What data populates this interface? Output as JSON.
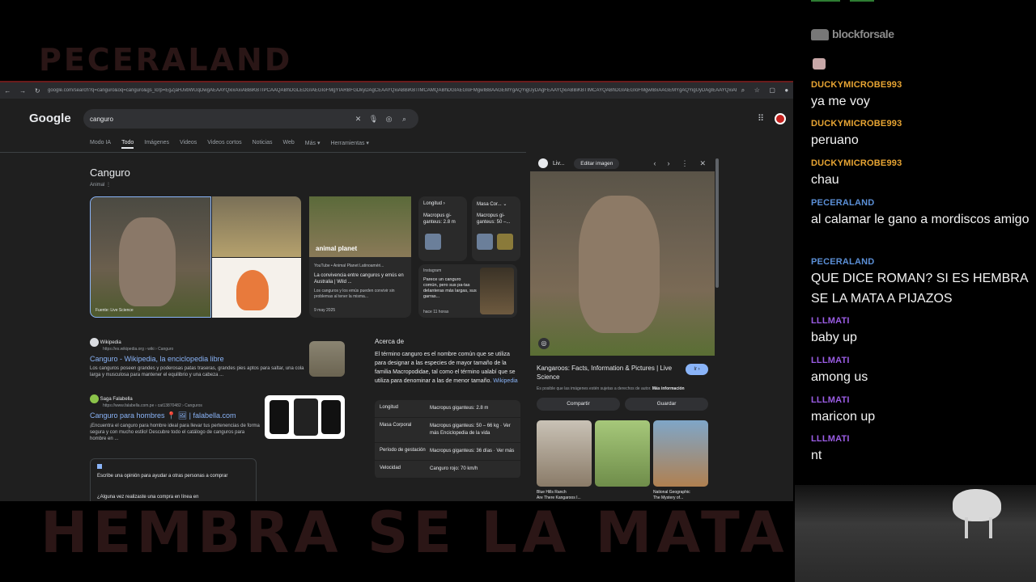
{
  "overlay": {
    "ghost_top": "PECERALAND",
    "ghost_bottom": "HEMBRA SE LA MATA A F"
  },
  "browser": {
    "url": "google.com/search?q=canguro&oq=canguro&gs_lcrp=EgZjaHJvbWUqDwgAEAAYQxixAxiABBiKBTIPCAAQABhDGLEDGIAEGIoFMgYIARBFGDkyDAgCEAAYQxiABBiKBTIMCAMQABhDGIAEGIoFMgwIBBAAGEMYgAQYigUyDAgFEAAYQxiABBiKBTIMCAYQABhDGIAEGIoFMgwIBxAAGEMYgAQYigUyDAgIEAAYQxiABBiKBTIMCAkQABhDGIAEGIoF0gEIMTYyNGowajeoAgCwAgA&sourceid=chrome&ie=UTF-8"
  },
  "google": {
    "logo": "Google",
    "query": "canguro",
    "tabs": [
      "Modo IA",
      "Todo",
      "Imágenes",
      "Videos",
      "Videos cortos",
      "Noticias",
      "Web",
      "Más ▾",
      "Herramientas ▾"
    ],
    "kp_title": "Canguro",
    "kp_sub": "Animal ⋮",
    "main_img_caption": "Fuente: Live Science",
    "video": {
      "brand": "animal planet",
      "source": "YouTube • Animal Planet Latinoaméri...",
      "title": "La convivencia entre canguros y emús en Australia | Wild ...",
      "snippet": "Los canguros y los emús pueden convivir sin problemas al tener la misma...",
      "date": "9 may 2025"
    },
    "mini_longitud": {
      "h": "Longitud  ›",
      "v": "Macropus gi-ganteus: 2.8 m"
    },
    "mini_masa": {
      "h": "Masa Cor...  ⌄",
      "v": "Macropus gi-ganteus: 50 –..."
    },
    "instagram": {
      "h": "Instagram",
      "t": "Parece un canguro común, pero sus pa-tas delanteras más largas, sus garras...",
      "d": "hace 11 horas"
    },
    "result1": {
      "site": "Wikipedia",
      "url": "https://es.wikipedia.org › wiki › Canguro",
      "title": "Canguro - Wikipedia, la enciclopedia libre",
      "snippet": "Los canguros poseen grandes y poderosas patas traseras, grandes pies aptos para saltar, una cola larga y musculosa para mantener el equilibrio y una cabeza ..."
    },
    "result2": {
      "site": "Saga Falabella",
      "url": "https://www.falabella.com.pe › cat13870482 › Canguros",
      "title": "Canguro para hombres 📍 🖼 | falabella.com",
      "snippet": "¡Encuentra el canguro para hombre ideal para llevar tus pertenencias de forma segura y con mucho estilo! Descubre todo el catálogo de canguros para hombre en ..."
    },
    "review": {
      "t": "Escribe una opinión para ayudar a otras personas a comprar",
      "s": "¿Alguna vez realizaste una compra en línea en"
    },
    "acerca": {
      "h": "Acerca de",
      "p": "El término canguro es el nombre común que se utiliza para designar a las especies de mayor tamaño de la familia Macropodidae, tal como el término ualabí que se utiliza para denominar a las de menor tamaño.",
      "wk": "Wikipedia"
    },
    "facts": [
      {
        "k": "Longitud",
        "v": "Macropus giganteus: 2.8 m"
      },
      {
        "k": "Masa Corporal",
        "v": "Macropus giganteus: 50 – 66 kg · Ver más  Enciclopedia de la vida"
      },
      {
        "k": "Período de gestación",
        "v": "Macropus giganteus: 36 días · Ver más"
      },
      {
        "k": "Velocidad",
        "v": "Canguro rojo: 70 km/h"
      }
    ]
  },
  "viewer": {
    "source_short": "Liv...",
    "edit": "Editar imagen",
    "title": "Kangaroos: Facts, Information & Pictures | Live Science",
    "ir": "Ir ›",
    "note": "Es posible que las imágenes estén sujetas a derechos de autor.",
    "note_link": "Más información",
    "share": "Compartir",
    "save": "Guardar",
    "rel1": "Blue Hills Ranch\nAre There Kangaroos I...",
    "rel3": "National Geographic\nThe Mystery of..."
  },
  "chat": {
    "brand": "blockforsale",
    "messages": [
      {
        "user": "DUCKYMICROBE993",
        "color": "#e8a533",
        "text": "ya me voy"
      },
      {
        "user": "DUCKYMICROBE993",
        "color": "#e8a533",
        "text": "peruano"
      },
      {
        "user": "DUCKYMICROBE993",
        "color": "#e8a533",
        "text": "chau"
      },
      {
        "user": "PECERALAND",
        "color": "#5b8fd6",
        "text": "al calamar le gano a mordiscos amigo"
      },
      {
        "user": "PECERALAND",
        "color": "#5b8fd6",
        "text": "QUE DICE ROMAN? SI ES HEMBRA SE LA MATA A PIJAZOS"
      },
      {
        "user": "LLLMATI",
        "color": "#9b5de5",
        "text": "baby up"
      },
      {
        "user": "LLLMATI",
        "color": "#9b5de5",
        "text": "among us"
      },
      {
        "user": "LLLMATI",
        "color": "#9b5de5",
        "text": "maricon up"
      },
      {
        "user": "LLLMATI",
        "color": "#9b5de5",
        "text": "nt"
      }
    ]
  }
}
